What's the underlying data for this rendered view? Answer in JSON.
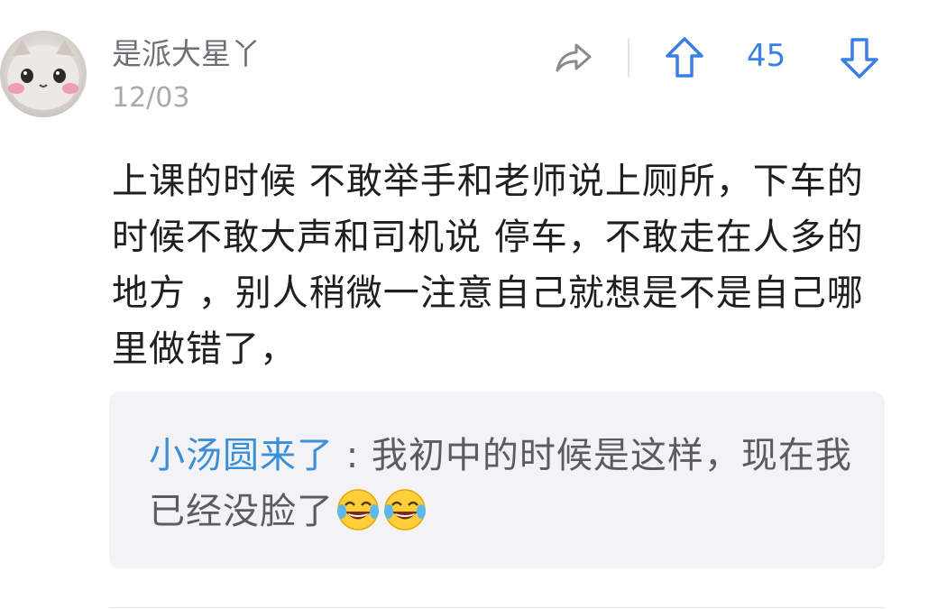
{
  "comment": {
    "username": "是派大星丫",
    "date": "12/03",
    "vote_count": "45",
    "text": "上课的时候 不敢举手和老师说上厕所，下车的时候不敢大声和司机说 停车，不敢走在人多的地方 ，别人稍微一注意自己就想是不是自己哪里做错了，",
    "icons": {
      "avatar": "cat-avatar",
      "share": "share-icon",
      "upvote": "upvote-arrow-icon",
      "downvote": "downvote-arrow-icon"
    }
  },
  "reply": {
    "username": "小汤圆来了",
    "separator": " : ",
    "text": "我初中的时候是这样，现在我已经没脸了",
    "emojis": [
      "laughing-crying-emoji",
      "laughing-crying-emoji"
    ]
  },
  "colors": {
    "accent": "#3a7fe4",
    "reply_user": "#3a8fd9",
    "reply_bg": "#f3f3f6"
  }
}
